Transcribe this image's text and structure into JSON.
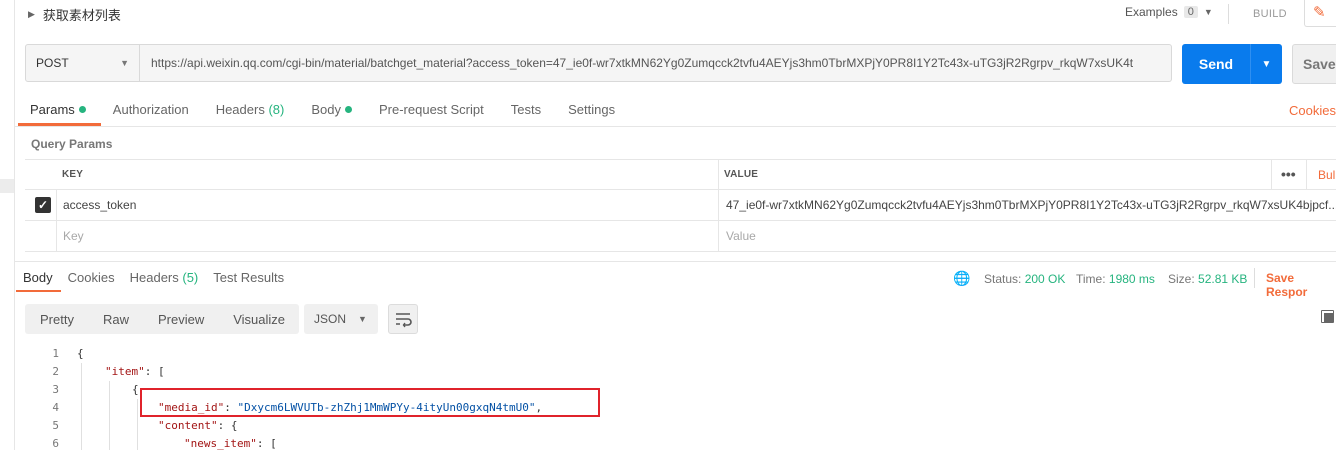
{
  "header": {
    "title": "获取素材列表",
    "examples_label": "Examples",
    "examples_count": "0",
    "build_label": "BUILD"
  },
  "request": {
    "method": "POST",
    "url": "https://api.weixin.qq.com/cgi-bin/material/batchget_material?access_token=47_ie0f-wr7xtkMN62Yg0Zumqcck2tvfu4AEYjs3hm0TbrMXPjY0PR8I1Y2Tc43x-uTG3jR2Rgrpv_rkqW7xsUK4t",
    "send_label": "Send",
    "save_label": "Save"
  },
  "request_tabs": [
    {
      "label": "Params",
      "extra": "",
      "dot": true
    },
    {
      "label": "Authorization",
      "extra": "",
      "dot": false
    },
    {
      "label": "Headers",
      "extra": "(8)",
      "dot": false
    },
    {
      "label": "Body",
      "extra": "",
      "dot": true
    },
    {
      "label": "Pre-request Script",
      "extra": "",
      "dot": false
    },
    {
      "label": "Tests",
      "extra": "",
      "dot": false
    },
    {
      "label": "Settings",
      "extra": "",
      "dot": false
    }
  ],
  "cookies_link": "Cookies",
  "query_params": {
    "section_label": "Query Params",
    "key_header": "KEY",
    "value_header": "VALUE",
    "bulk_label": "Bul",
    "rows": [
      {
        "key": "access_token",
        "value": "47_ie0f-wr7xtkMN62Yg0Zumqcck2tvfu4AEYjs3hm0TbrMXPjY0PR8I1Y2Tc43x-uTG3jR2Rgrpv_rkqW7xsUK4bjpcf..."
      }
    ],
    "key_placeholder": "Key",
    "value_placeholder": "Value"
  },
  "response_tabs": [
    {
      "label": "Body",
      "extra": ""
    },
    {
      "label": "Cookies",
      "extra": ""
    },
    {
      "label": "Headers",
      "extra": "(5)"
    },
    {
      "label": "Test Results",
      "extra": ""
    }
  ],
  "response_status": {
    "status_label": "Status:",
    "status_value": "200 OK",
    "time_label": "Time:",
    "time_value": "1980 ms",
    "size_label": "Size:",
    "size_value": "52.81 KB",
    "save_response": "Save Respor"
  },
  "view_modes": [
    "Pretty",
    "Raw",
    "Preview",
    "Visualize"
  ],
  "format_select": "JSON",
  "code_lines": [
    {
      "n": "1",
      "text": "{"
    },
    {
      "n": "2",
      "key": "\"item\"",
      "rest": ": ["
    },
    {
      "n": "3",
      "text": "{"
    },
    {
      "n": "4",
      "key": "\"media_id\"",
      "sep": ": ",
      "str": "\"Dxycm6LWVUTb-zhZhj1MmWPYy-4ityUn00gxqN4tmU0\"",
      "rest": ","
    },
    {
      "n": "5",
      "key": "\"content\"",
      "rest": ": {"
    },
    {
      "n": "6",
      "key": "\"news_item\"",
      "rest": ": ["
    }
  ]
}
